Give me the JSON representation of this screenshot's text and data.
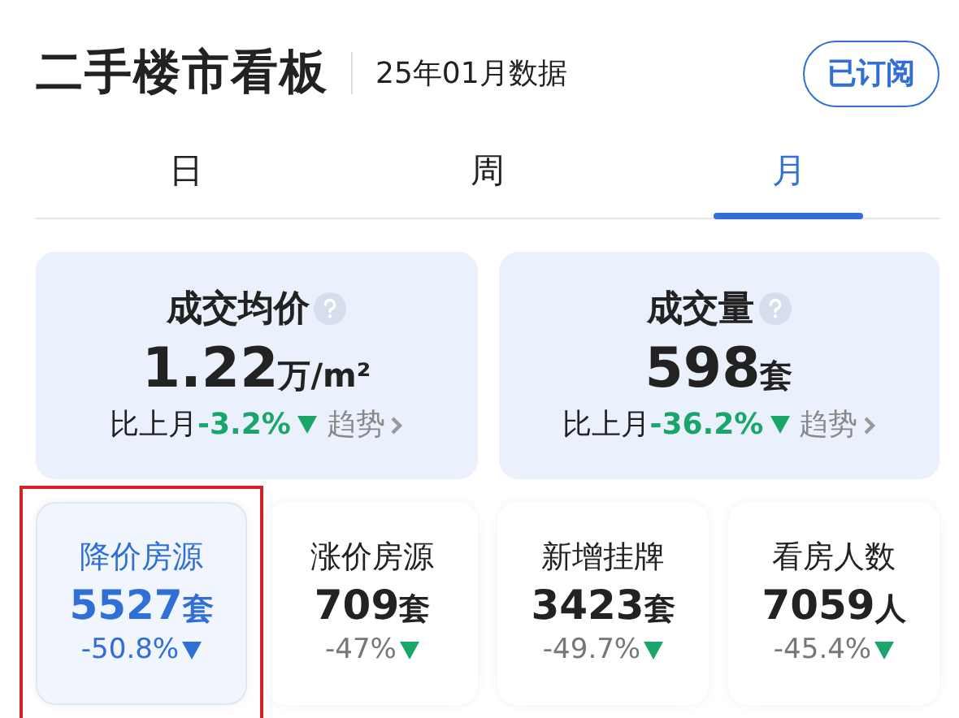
{
  "header": {
    "title": "二手楼市看板",
    "subtitle": "25年01月数据",
    "subscribe_button": "已订阅"
  },
  "tabs": [
    {
      "label": "日",
      "selected": false
    },
    {
      "label": "周",
      "selected": false
    },
    {
      "label": "月",
      "selected": true
    }
  ],
  "main_metrics": [
    {
      "title": "成交均价",
      "value": "1.22",
      "unit": "万/m²",
      "compare_label": "比上月",
      "change": "-3.2%",
      "falling": true,
      "trend_link": "趋势"
    },
    {
      "title": "成交量",
      "value": "598",
      "unit": "套",
      "compare_label": "比上月",
      "change": "-36.2%",
      "falling": true,
      "trend_link": "趋势"
    }
  ],
  "sub_metrics": [
    {
      "title": "降价房源",
      "value": "5527",
      "unit": "套",
      "change": "-50.8%",
      "falling": true,
      "selected": true,
      "highlighted": true
    },
    {
      "title": "涨价房源",
      "value": "709",
      "unit": "套",
      "change": "-47%",
      "falling": true,
      "selected": false,
      "highlighted": false
    },
    {
      "title": "新增挂牌",
      "value": "3423",
      "unit": "套",
      "change": "-49.7%",
      "falling": true,
      "selected": false,
      "highlighted": false
    },
    {
      "title": "看房人数",
      "value": "7059",
      "unit": "人",
      "change": "-45.4%",
      "falling": true,
      "selected": false,
      "highlighted": false
    }
  ]
}
